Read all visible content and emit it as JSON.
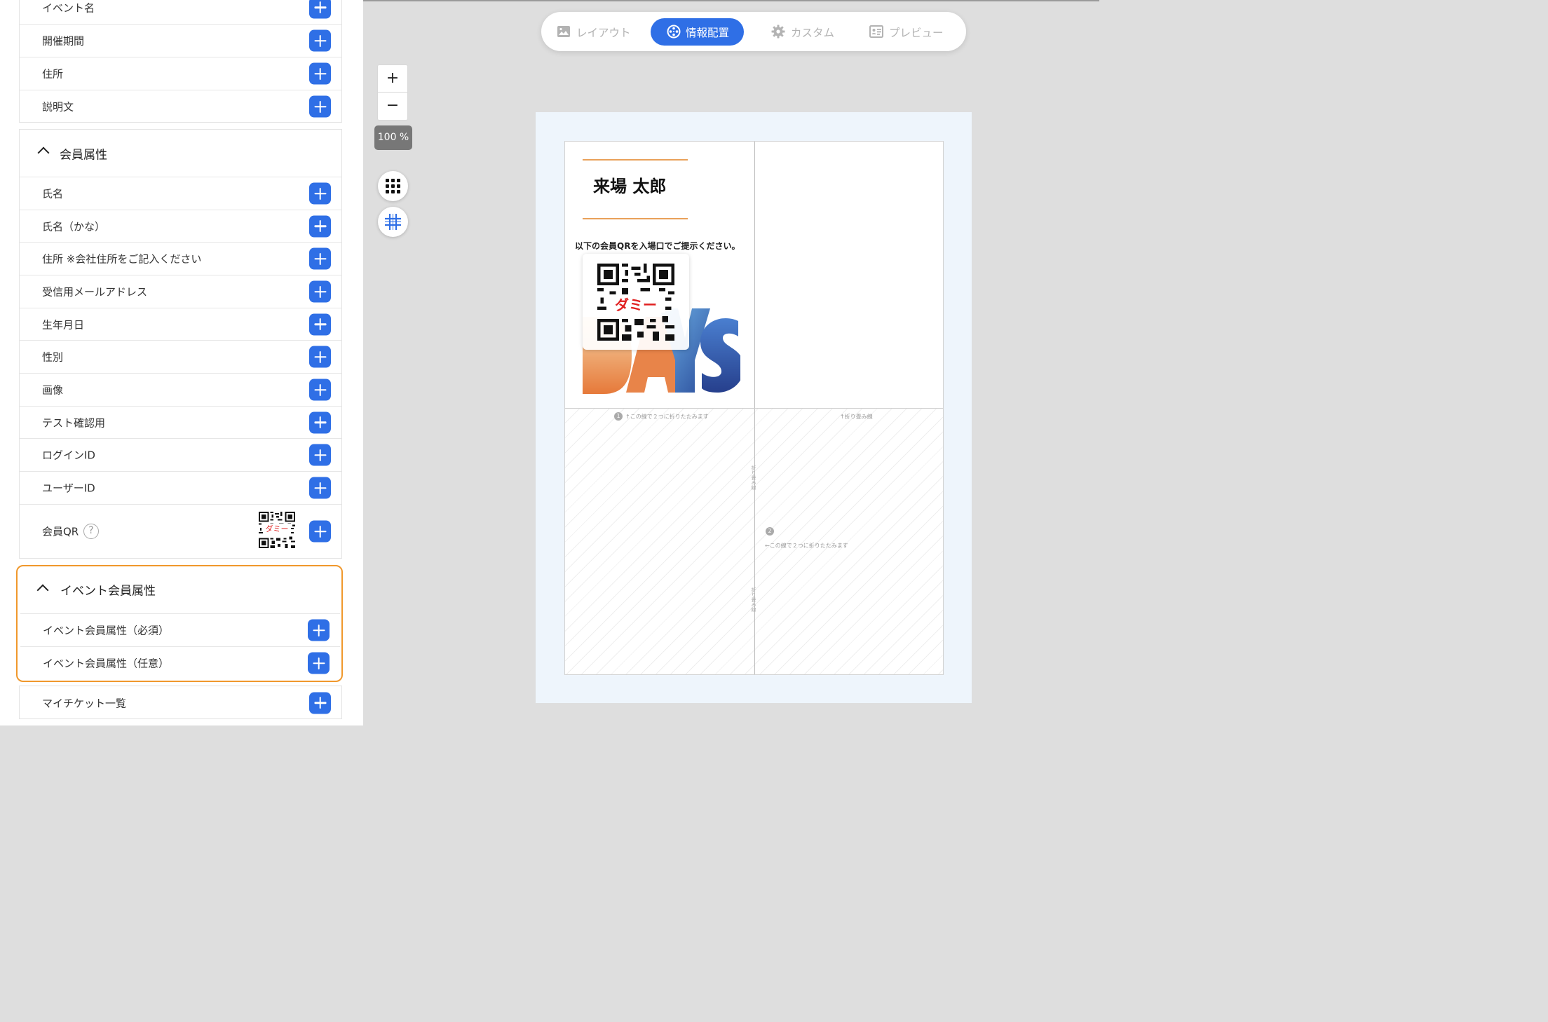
{
  "event_info": {
    "items": [
      {
        "label": "イベント名"
      },
      {
        "label": "開催期間"
      },
      {
        "label": "住所"
      },
      {
        "label": "説明文"
      }
    ]
  },
  "member_attributes": {
    "title": "会員属性",
    "items": [
      {
        "label": "氏名"
      },
      {
        "label": "氏名（かな）"
      },
      {
        "label": "住所 ※会社住所をご記入ください"
      },
      {
        "label": "受信用メールアドレス"
      },
      {
        "label": "生年月日"
      },
      {
        "label": "性別"
      },
      {
        "label": "画像"
      },
      {
        "label": "テスト確認用"
      },
      {
        "label": "ログインID"
      },
      {
        "label": "ユーザーID"
      }
    ],
    "qr_row": {
      "label": "会員QR",
      "help_glyph": "?",
      "thumb_label": "ダミー"
    }
  },
  "event_member_attributes": {
    "title": "イベント会員属性",
    "items": [
      {
        "label": "イベント会員属性（必須）"
      },
      {
        "label": "イベント会員属性（任意）"
      }
    ]
  },
  "my_tickets": {
    "label": "マイチケット一覧"
  },
  "toolbar": {
    "tabs": [
      {
        "label": "レイアウト",
        "icon": "image-icon",
        "active": false
      },
      {
        "label": "情報配置",
        "icon": "film-reel-icon",
        "active": true
      },
      {
        "label": "カスタム",
        "icon": "gear-icon",
        "active": false
      },
      {
        "label": "プレビュー",
        "icon": "id-card-icon",
        "active": false
      }
    ]
  },
  "zoom": {
    "in_label": "+",
    "out_label": "−",
    "level": "100 %"
  },
  "ticket": {
    "name": "来場 太郎",
    "instruction": "以下の会員QRを入場口でご提示ください。",
    "qr_label": "ダミー",
    "fold_note_1": "↑この線で２つに折りたたみます",
    "fold_note_top_right": "↑折り畳み線",
    "fold_note_2": "←この線で２つに折りたたみます",
    "fold_vertical": "折り畳み線",
    "num_1": "1",
    "num_2": "2"
  },
  "colors": {
    "accent": "#2f6fe6",
    "highlight": "#f0982c",
    "gold_line": "#e9a15a",
    "qr_dummy_text": "#e02020"
  }
}
